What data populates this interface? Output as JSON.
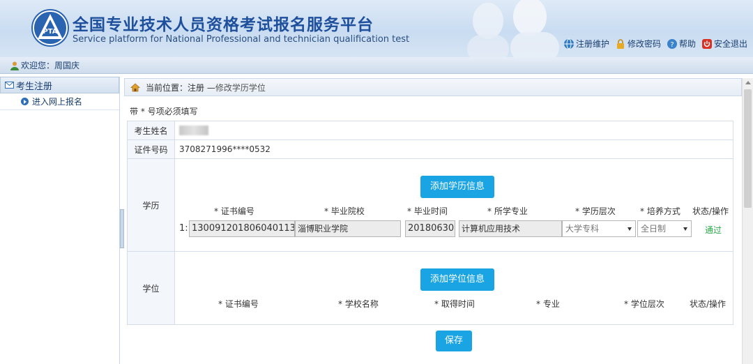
{
  "header": {
    "title_cn": "全国专业技术人员资格考试报名服务平台",
    "title_en": "Service platform for National Professional and technician qualification test",
    "logo_text": "PTA",
    "links": [
      {
        "label": "注册维护",
        "icon": "globe-icon"
      },
      {
        "label": "修改密码",
        "icon": "lock-icon"
      },
      {
        "label": "帮助",
        "icon": "help-icon"
      },
      {
        "label": "安全退出",
        "icon": "power-icon"
      }
    ]
  },
  "welcome": {
    "text": "欢迎您：周国庆"
  },
  "sidebar": {
    "header": "考生注册",
    "items": [
      {
        "label": "进入网上报名"
      }
    ]
  },
  "breadcrumb": {
    "prefix": "当前位置：",
    "path": "注册 — ",
    "current": "修改学历学位"
  },
  "form": {
    "note": "带 * 号项必须填写",
    "name_label": "考生姓名",
    "id_label": "证件号码",
    "id_value": "3708271996****0532",
    "education": {
      "label": "学历",
      "add_button": "添加学历信息",
      "columns": [
        "* 证书编号",
        "* 毕业院校",
        "* 毕业时间",
        "* 所学专业",
        "* 学历层次",
        "* 培养方式",
        "状态/操作"
      ],
      "rows": [
        {
          "index": "1:",
          "cert_no": "130091201806040113",
          "school": "淄博职业学院",
          "grad_date": "20180630",
          "major": "计算机应用技术",
          "level": "大学专科",
          "mode": "全日制",
          "status": "通过"
        }
      ]
    },
    "degree": {
      "label": "学位",
      "add_button": "添加学位信息",
      "columns": [
        "* 证书编号",
        "* 学校名称",
        "* 取得时间",
        "* 专业",
        "* 学位层次",
        "状态/操作"
      ]
    },
    "save_button": "保存"
  },
  "colors": {
    "accent": "#1aa4e3",
    "status_ok": "#28a745",
    "title": "#1d4f9c"
  }
}
